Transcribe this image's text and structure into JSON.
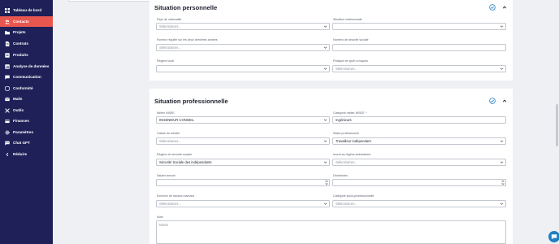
{
  "sidebar": {
    "items": [
      {
        "label": "Tableau de bord",
        "icon": "dashboard-icon"
      },
      {
        "label": "Contacts",
        "icon": "contacts-icon",
        "active": true
      },
      {
        "label": "Projets",
        "icon": "projects-icon"
      },
      {
        "label": "Contrats",
        "icon": "contracts-icon"
      },
      {
        "label": "Produits",
        "icon": "products-icon"
      },
      {
        "label": "Analyse de données",
        "icon": "analytics-icon"
      },
      {
        "label": "Communication",
        "icon": "communication-icon"
      },
      {
        "label": "Conformité",
        "icon": "compliance-icon"
      },
      {
        "label": "Mails",
        "icon": "mail-icon"
      },
      {
        "label": "Outils",
        "icon": "tools-icon"
      },
      {
        "label": "Finances",
        "icon": "finances-icon"
      },
      {
        "label": "Paramètres",
        "icon": "settings-icon"
      },
      {
        "label": "Chat GPT",
        "icon": "chat-gpt-icon"
      },
      {
        "label": "Réduire",
        "icon": "collapse-icon"
      }
    ]
  },
  "personal": {
    "title": "Situation personnelle",
    "fields": {
      "nationality": {
        "label": "Pays de nationalité",
        "value": "Sélectionner..."
      },
      "marital": {
        "label": "Situation matrimoniale",
        "value": ""
      },
      "smoker": {
        "label": "Fumeur régulier sur les deux dernières années",
        "value": "Sélectionner..."
      },
      "social_number": {
        "label": "Numéro de sécurité sociale",
        "value": ""
      },
      "local_regime": {
        "label": "Régime local",
        "value": ""
      },
      "risk_practice": {
        "label": "Pratique de sport à risques",
        "value": "Sélectionner..."
      }
    }
  },
  "professional": {
    "title": "Situation professionnelle",
    "fields": {
      "insee_job": {
        "label": "Métier INSEE",
        "value": "INGENIEUR CONSEIL"
      },
      "insee_category": {
        "label": "Catégorie métier INSEE *",
        "value": "Ingénieurs"
      },
      "retirement_fund": {
        "label": "Caisse de retraite",
        "value": "Sélectionner..."
      },
      "pro_status": {
        "label": "Statut professionnel",
        "value": "Travailleur indépendant"
      },
      "social_regime": {
        "label": "Régime de sécurité sociale",
        "value": "Sécurité Sociale des indépendants"
      },
      "unemployment": {
        "label": "Inscrit au régime ambulatoire",
        "value": "Sélectionner..."
      },
      "annual_salary": {
        "label": "Salaire annuel",
        "value": ""
      },
      "dividends": {
        "label": "Dividendes",
        "value": ""
      },
      "manual_work": {
        "label": "Exercice de travaux manuels",
        "value": "Sélectionner..."
      },
      "socio_category": {
        "label": "Catégorie socio-professionnelle",
        "value": "Sélectionner..."
      },
      "notes": {
        "label": "Note",
        "placeholder": "Notes"
      }
    }
  },
  "colors": {
    "sidebar_bg": "#1e2057",
    "active_item": "#e8574f",
    "accent_check": "#1f7fc0",
    "chat_bubble": "#1f7fc0"
  }
}
